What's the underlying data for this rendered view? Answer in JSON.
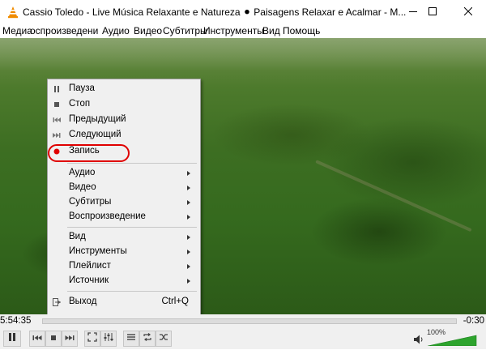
{
  "window": {
    "title": "Cassio Toledo - Live Música Relaxante e Natureza  ⚫ Paisagens Relaxar e Acalmar - M..."
  },
  "menubar": {
    "items": [
      "Медиа",
      "оспроизведени",
      "Аудио",
      "Видео",
      "Субтитры",
      "Инструменты",
      "Вид",
      "Помощь"
    ]
  },
  "context_menu": {
    "items": [
      {
        "label": "Пауза",
        "icon": "pause-icon"
      },
      {
        "label": "Стоп",
        "icon": "stop-icon"
      },
      {
        "label": "Предыдущий",
        "icon": "previous-icon"
      },
      {
        "label": "Следующий",
        "icon": "next-icon"
      },
      {
        "label": "Запись",
        "icon": "record-icon"
      },
      {
        "label": "Аудио"
      },
      {
        "label": "Видео"
      },
      {
        "label": "Субтитры"
      },
      {
        "label": "Воспроизведение"
      },
      {
        "label": "Вид"
      },
      {
        "label": "Инструменты"
      },
      {
        "label": "Плейлист"
      },
      {
        "label": "Источник"
      },
      {
        "label": "Выход",
        "icon": "exit-icon",
        "shortcut": "Ctrl+Q"
      }
    ]
  },
  "seek": {
    "elapsed": "5:54:35",
    "remaining": "-0:30",
    "progress": 0.999
  },
  "volume": {
    "label": "100%",
    "level": 1.0
  },
  "colors": {
    "highlight": "#e00000",
    "volume_fill": "#2ea42e"
  }
}
